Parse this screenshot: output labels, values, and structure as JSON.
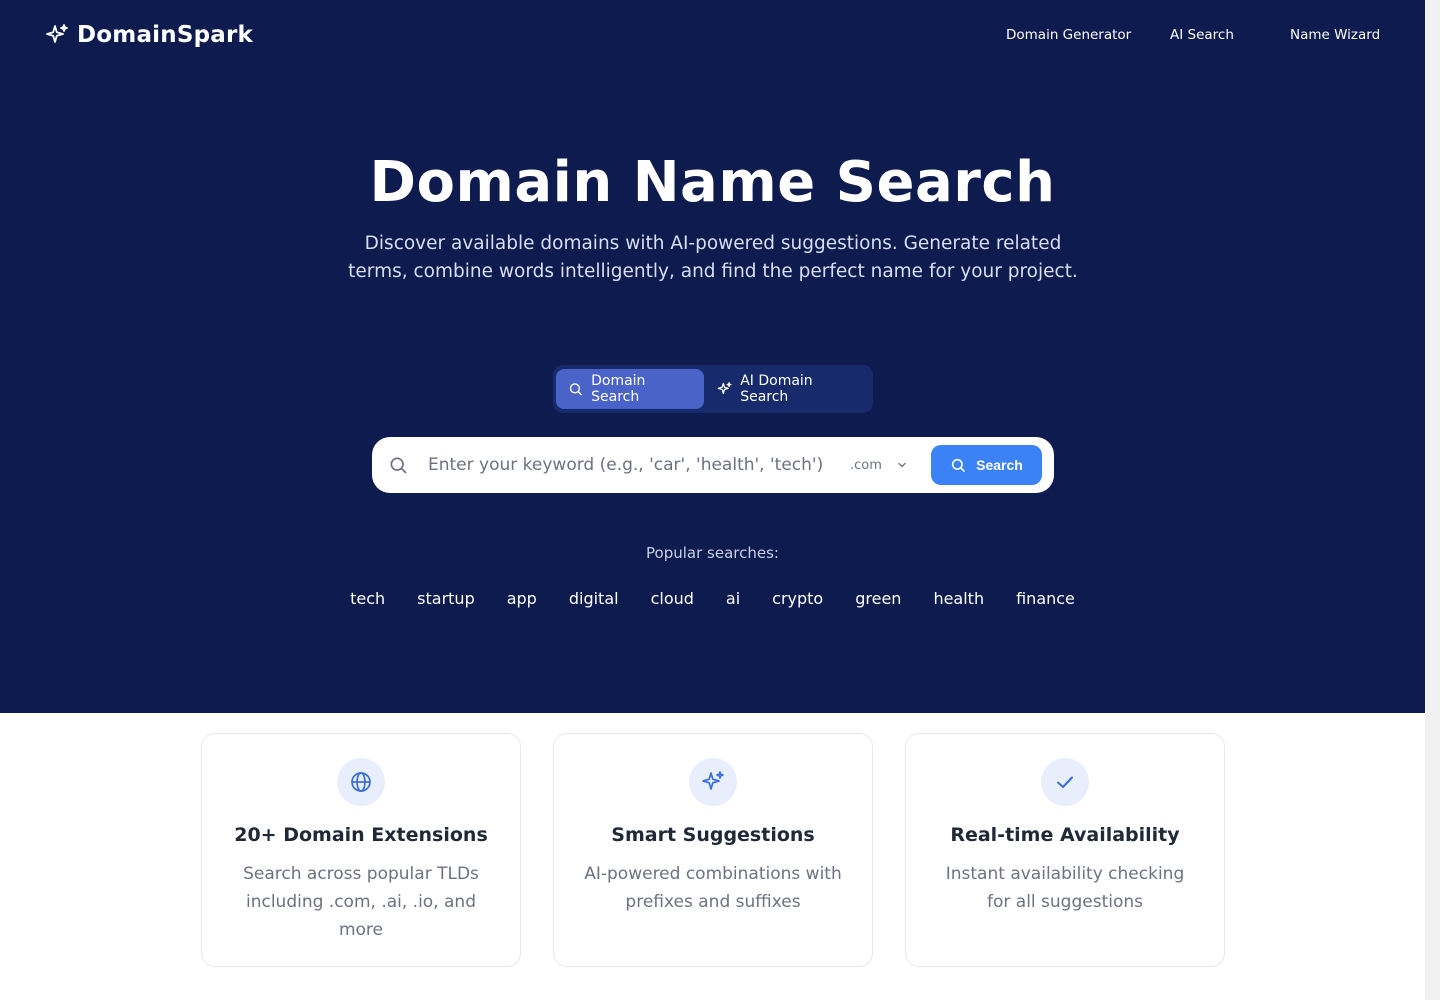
{
  "brand": {
    "name": "DomainSpark",
    "icon": "sparkles-icon"
  },
  "nav": {
    "items": [
      "Domain Generator",
      "AI Search",
      "Name Wizard"
    ]
  },
  "hero": {
    "title": "Domain Name Search",
    "subtitle": "Discover available domains with AI-powered suggestions. Generate related terms, combine words intelligently, and find the perfect name for your project."
  },
  "modes": {
    "domain_search": "Domain Search",
    "ai_domain_search": "AI Domain Search",
    "active": "Domain Search"
  },
  "search": {
    "placeholder": "Enter your keyword (e.g., 'car', 'health', 'tech')",
    "value": "",
    "tld": ".com",
    "button": "Search"
  },
  "popular": {
    "label": "Popular searches:",
    "terms": [
      "tech",
      "startup",
      "app",
      "digital",
      "cloud",
      "ai",
      "crypto",
      "green",
      "health",
      "finance"
    ]
  },
  "features": [
    {
      "icon": "globe-icon",
      "title": "20+ Domain Extensions",
      "description": "Search across popular TLDs including .com, .ai, .io, and more"
    },
    {
      "icon": "sparkles-icon",
      "title": "Smart Suggestions",
      "description": "AI-powered combinations with prefixes and suffixes"
    },
    {
      "icon": "check-icon",
      "title": "Real-time Availability",
      "description": "Instant availability checking for all suggestions"
    }
  ],
  "colors": {
    "hero_bg": "#0d1b4f",
    "accent": "#3b82f6",
    "active_tab": "#4a63c9"
  }
}
